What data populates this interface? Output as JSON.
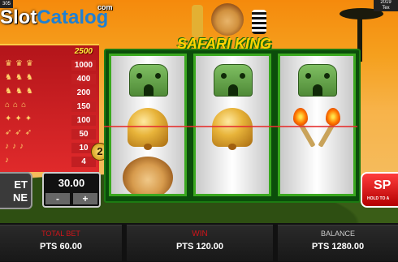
{
  "header": {
    "top_left": "305",
    "top_right": [
      "2019",
      "Tex"
    ],
    "logo_main": "Slot",
    "logo_accent": "Catalog",
    "logo_suffix": "com",
    "game_title": "SAFARI KING"
  },
  "paytable": {
    "top_value": "2500",
    "rows": [
      "1000",
      "400",
      "200",
      "150",
      "100",
      "50",
      "10",
      "4"
    ],
    "lines_badge": "2"
  },
  "reels": [
    [
      "hut",
      "bell",
      "lion"
    ],
    [
      "hut",
      "bell",
      ""
    ],
    [
      "hut",
      "torches",
      ""
    ]
  ],
  "controls": {
    "bet_line_label_1": "ET",
    "bet_line_label_2": "NE",
    "bet_amount": "30.00",
    "minus": "-",
    "plus": "+",
    "spin_label": "SP",
    "spin_hint": "HOLD TO A"
  },
  "status": {
    "total_bet_label": "TOTAL BET",
    "total_bet_value": "PTS 60.00",
    "win_label": "WIN",
    "win_value": "PTS 120.00",
    "balance_label": "BALANCE",
    "balance_value": "PTS 1280.00"
  },
  "colors": {
    "accent_red": "#d0141a",
    "reel_border": "#3aa81f",
    "title_yellow": "#ffd400"
  }
}
